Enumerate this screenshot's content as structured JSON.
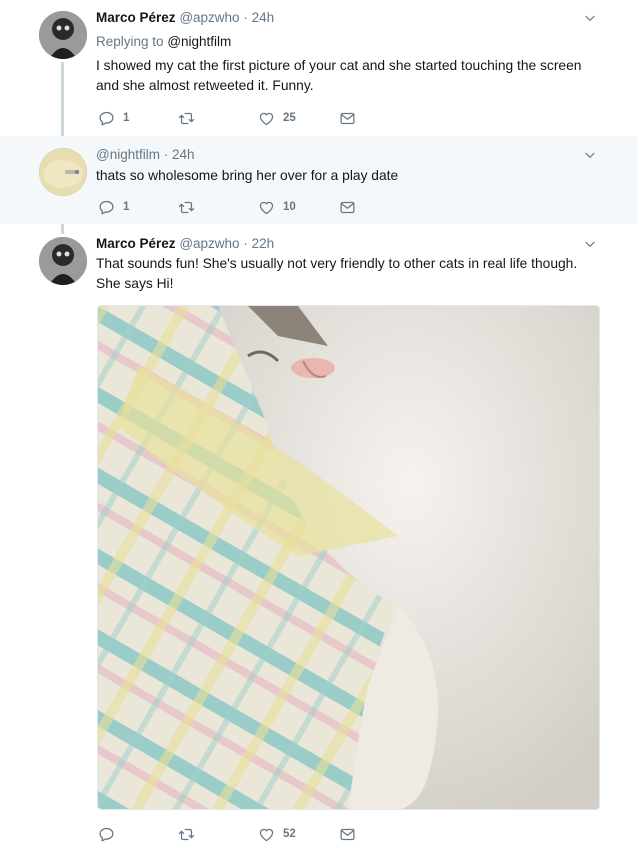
{
  "tweets": [
    {
      "name": "Marco Pérez",
      "handle": "@apzwho",
      "time": "24h",
      "replying_label": "Replying to",
      "replying_to": "@nightfilm",
      "text_lines": [
        "I showed my cat the first picture of your cat and she started touching the screen",
        "and she almost retweeted it. Funny."
      ],
      "reply_count": "1",
      "like_count": "25"
    },
    {
      "handle": "@nightfilm",
      "time": "24h",
      "text_lines": [
        "thats so wholesome bring her over for a play date"
      ],
      "reply_count": "1",
      "like_count": "10"
    },
    {
      "name": "Marco Pérez",
      "handle": "@apzwho",
      "time": "22h",
      "text_lines": [
        "That sounds fun! She's usually not very friendly to other cats in real life though.",
        "She says Hi!"
      ],
      "like_count": "52"
    }
  ],
  "separator": "·",
  "colors": {
    "text": "#14171a",
    "secondary": "#657786",
    "highlight_bg": "#f5f8fa",
    "thread_line": "#ccd6dd"
  },
  "icons": [
    "reply-icon",
    "retweet-icon",
    "like-icon",
    "direct-message-icon",
    "chevron-down-icon"
  ]
}
